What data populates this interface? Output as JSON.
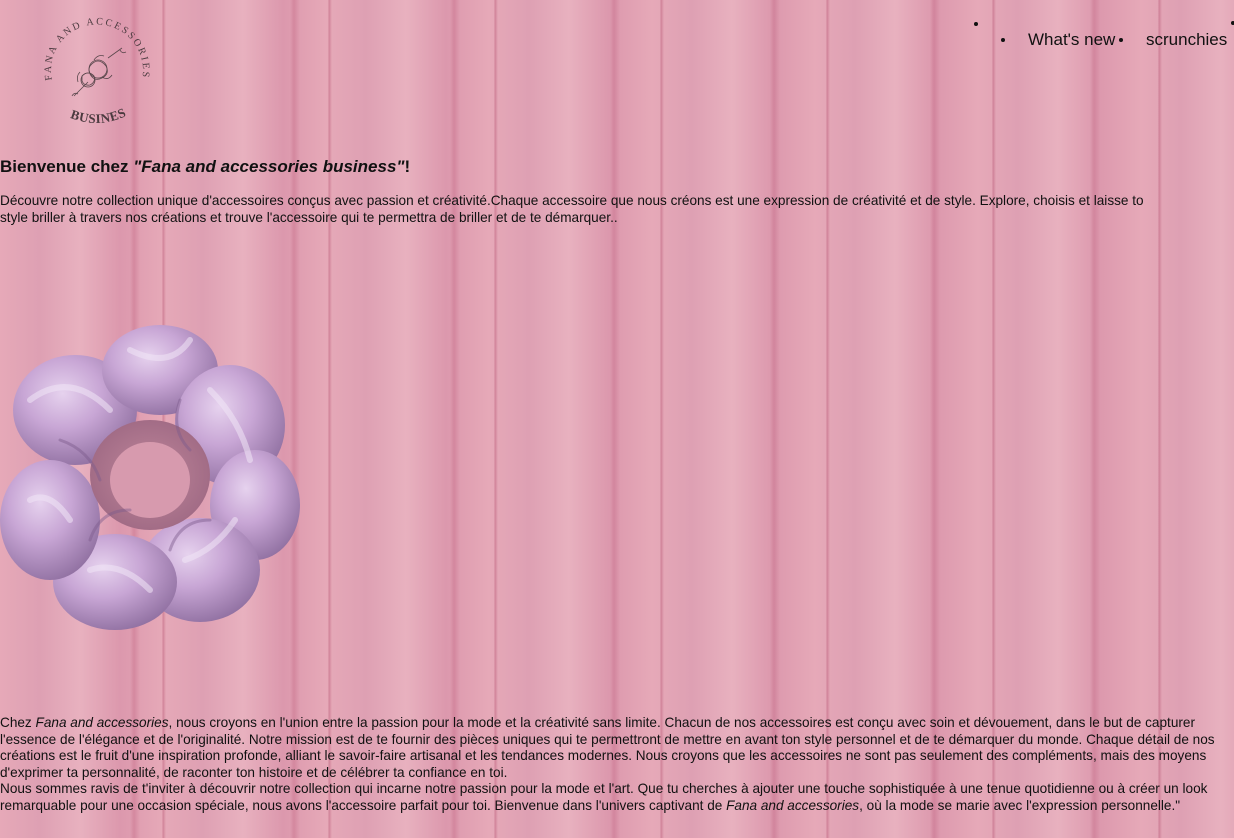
{
  "brand": {
    "logo_top_text": "FANA AND ACCESSORIES",
    "logo_bottom_text": "BUSINESS"
  },
  "nav": {
    "items": [
      {
        "label": "What's new"
      },
      {
        "label": "scrunchies"
      }
    ]
  },
  "intro": {
    "welcome_prefix": "Bienvenue chez ",
    "welcome_brand": "\"Fana and accessories business\"",
    "welcome_suffix": "!",
    "text": "Découvre notre collection unique d'accessoires conçus avec passion et créativité.Chaque accessoire que nous créons est une expression de créativité et de style. Explore, choisis et laisse to\nstyle briller à travers nos créations et trouve l'accessoire qui te permettra de briller et de te démarquer.."
  },
  "hero_image": {
    "name": "lilac satin scrunchie"
  },
  "about": {
    "chez": "Chez ",
    "brand1": "Fana and accessories",
    "text1": ", nous croyons en l'union entre la passion pour la mode et la créativité sans limite. Chacun de nos accessoires est conçu avec soin et dévouement, dans le but de capturer l'essence de l'élégance et de l'originalité. Notre mission est de te fournir des pièces uniques qui te permettront de mettre en avant ton style personnel et de te démarquer du monde. Chaque détail de nos créations est le fruit d'une inspiration profonde, alliant le savoir-faire artisanal et les tendances modernes. Nous croyons que les accessoires ne sont pas seulement des compléments, mais des moyens d'exprimer ta personnalité, de raconter ton histoire et de célébrer ta confiance en toi.",
    "text2": "Nous sommes ravis de t'inviter à découvrir notre collection qui incarne notre passion pour la mode et l'art. Que tu cherches à ajouter une touche sophistiquée à une tenue quotidienne ou à créer un look remarquable pour une occasion spéciale, nous avons l'accessoire parfait pour toi. Bienvenue dans l'univers captivant de ",
    "brand2": "Fana and accessories",
    "text3": ", où la mode se marie avec l'expression personnelle.\""
  },
  "colors": {
    "background": "#e2a5b6",
    "scrunchie": "#c9a8d6"
  }
}
